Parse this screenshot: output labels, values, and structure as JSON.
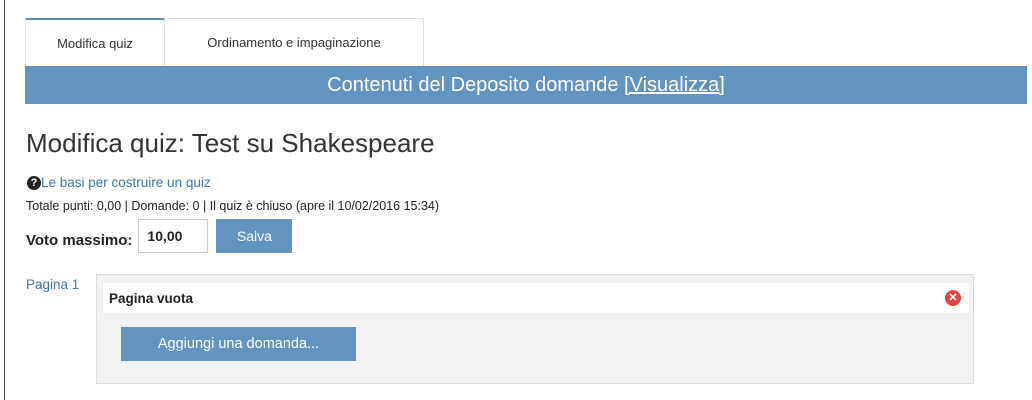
{
  "tabs": [
    {
      "label": "Modifica quiz"
    },
    {
      "label": "Ordinamento e impaginazione"
    }
  ],
  "banner": {
    "text": "Contenuti del Deposito domande ",
    "link": "[Visualizza]"
  },
  "heading": "Modifica quiz: Test su Shakespeare",
  "help": {
    "icon": "question-circle-icon",
    "text": "Le basi per costruire un quiz"
  },
  "totals": "Totale punti: 0,00 | Domande: 0 | Il quiz è chiuso (apre il 10/02/2016 15:34)",
  "grade": {
    "label": "Voto massimo:",
    "value": "10,00",
    "save": "Salva"
  },
  "page": {
    "label": "Pagina 1",
    "empty_title": "Pagina vuota",
    "add_button": "Aggiungi una domanda...",
    "delete_icon": "delete-circle-icon"
  },
  "colors": {
    "accent": "#6394bf",
    "link": "#3f77ad",
    "delete": "#e0483d"
  }
}
